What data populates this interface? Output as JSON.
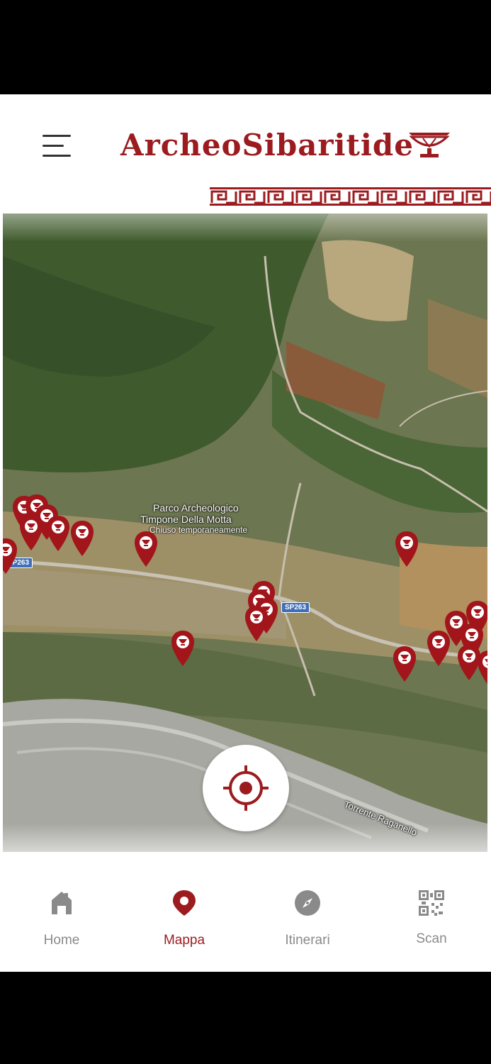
{
  "app": {
    "title": "ArcheoSibaritide"
  },
  "header": {
    "menu_icon": "hamburger-menu-icon",
    "logo_icon": "greek-vase-icon"
  },
  "map": {
    "labels": {
      "park_line1": "Parco Archeologico",
      "park_line2": "Timpone Della Motta",
      "park_status": "Chiuso temporaneamente",
      "road1": "SP263",
      "road2": "SP263",
      "river": "Torrente Raganello"
    },
    "pin_icon": "map-pin-vase-icon",
    "locate_icon": "crosshair-target-icon"
  },
  "nav": {
    "items": [
      {
        "label": "Home",
        "icon": "house-icon",
        "active": false
      },
      {
        "label": "Mappa",
        "icon": "map-pin-icon",
        "active": true
      },
      {
        "label": "Itinerari",
        "icon": "compass-icon",
        "active": false
      },
      {
        "label": "Scan",
        "icon": "qr-code-icon",
        "active": false
      }
    ]
  },
  "colors": {
    "accent": "#9b1b1f",
    "inactive": "#8a8a8a",
    "pin": "#a1151b"
  }
}
